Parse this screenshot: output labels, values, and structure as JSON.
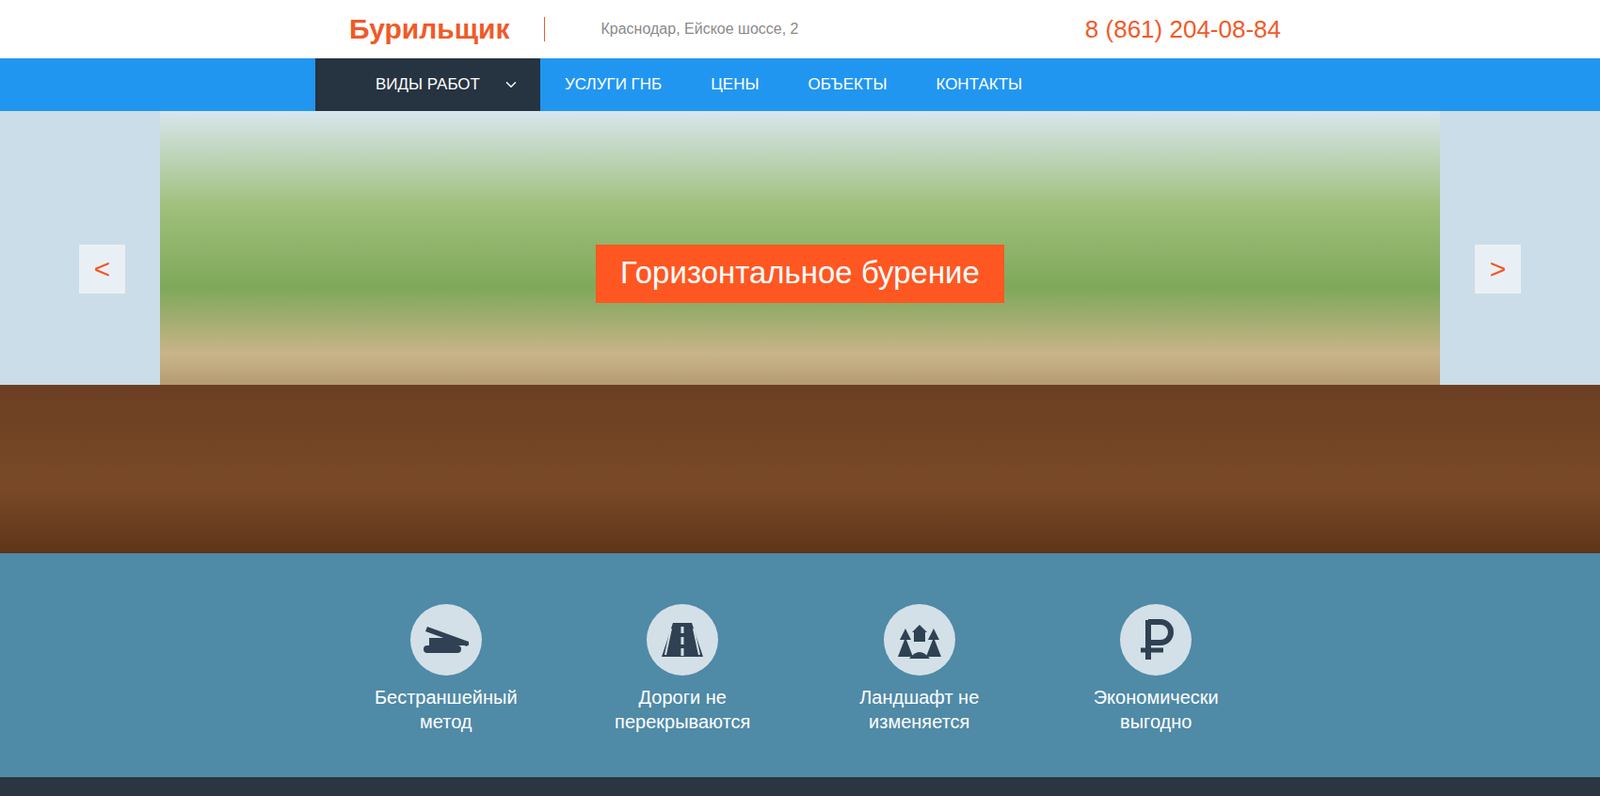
{
  "header": {
    "logo": "Бурильщик",
    "address": "Краснодар, Ейское шоссе, 2",
    "phone": "8 (861) 204-08-84"
  },
  "nav": [
    {
      "label": "ВИДЫ РАБОТ",
      "kind": "dropdown",
      "selected": true
    },
    {
      "label": "УСЛУГИ ГНБ",
      "kind": "link",
      "selected": false
    },
    {
      "label": "ЦЕНЫ",
      "kind": "link",
      "selected": false
    },
    {
      "label": "ОБЪЕКТЫ",
      "kind": "link",
      "selected": false
    },
    {
      "label": "КОНТАКТЫ",
      "kind": "link",
      "selected": false
    }
  ],
  "slider": {
    "title": "Горизонтальное бурение",
    "prev": "<",
    "next": ">"
  },
  "features": [
    {
      "label": "Бестраншейный метод"
    },
    {
      "label": "Дороги не перекрываются"
    },
    {
      "label": "Ландшафт не изменяется"
    },
    {
      "label": "Экономически выгодно"
    }
  ]
}
